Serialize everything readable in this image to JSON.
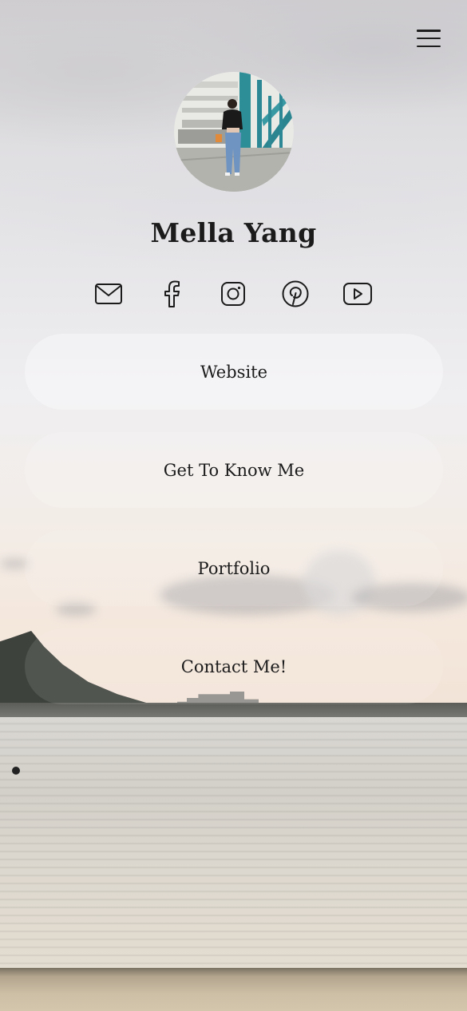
{
  "profile": {
    "name": "Mella Yang",
    "avatar_icon": "profile-photo"
  },
  "header": {
    "menu_icon": "hamburger-menu-icon"
  },
  "socials": [
    {
      "icon": "email-icon"
    },
    {
      "icon": "facebook-icon"
    },
    {
      "icon": "instagram-icon"
    },
    {
      "icon": "pinterest-icon"
    },
    {
      "icon": "youtube-icon"
    }
  ],
  "links": [
    {
      "label": "Website"
    },
    {
      "label": "Get To Know Me"
    },
    {
      "label": "Portfolio"
    },
    {
      "label": "Contact Me!"
    }
  ],
  "colors": {
    "text": "#1b1b1b",
    "button_fill": "rgba(255,255,255,0.45)"
  }
}
